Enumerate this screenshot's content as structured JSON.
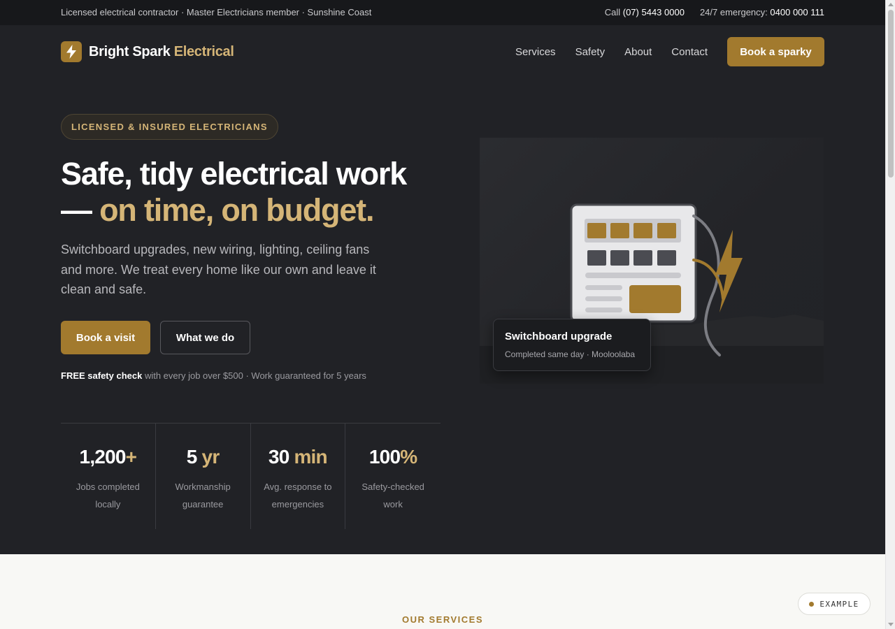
{
  "topbar": {
    "left_text": "Licensed electrical contractor · Master Electricians member · Sunshine Coast",
    "call_label": "Call",
    "call_number": "(07) 5443 0000",
    "emergency_label": "24/7 emergency:",
    "emergency_number": "0400 000 111"
  },
  "brand": {
    "name": "Bright Spark",
    "accent": "Electrical",
    "icon": "lightning-bolt-icon",
    "accent_color": "#a27a2e",
    "highlight_color": "#d5b577"
  },
  "nav": {
    "items": [
      "Services",
      "Safety",
      "About",
      "Contact"
    ],
    "cta": "Book a sparky"
  },
  "hero": {
    "badge": "LICENSED & INSURED ELECTRICIANS",
    "headline_line1": "Safe, tidy electrical work",
    "headline_dash": "— ",
    "headline_highlight": "on time, on budget.",
    "subtext": "Switchboard upgrades, new wiring, lighting, ceiling fans and more. We treat every home like our own and leave it clean and safe.",
    "primary_button": "Book a visit",
    "secondary_button": "What we do",
    "note_bold": "FREE safety check",
    "note_rest": " with every job over $500 · Work guaranteed for 5 years"
  },
  "stats": [
    {
      "value": "1,200",
      "suffix": "+",
      "label": "Jobs completed locally"
    },
    {
      "value": "5",
      "suffix": " yr",
      "label": "Workmanship guarantee"
    },
    {
      "value": "30",
      "suffix": " min",
      "label": "Avg. response to emergencies"
    },
    {
      "value": "100",
      "suffix": "%",
      "label": "Safety-checked work"
    }
  ],
  "showcase": {
    "illustration": "switchboard-illustration",
    "card_title": "Switchboard upgrade",
    "card_subtitle": "Completed same day · Mooloolaba"
  },
  "services": {
    "eyebrow": "OUR SERVICES"
  },
  "example_badge": "EXAMPLE"
}
